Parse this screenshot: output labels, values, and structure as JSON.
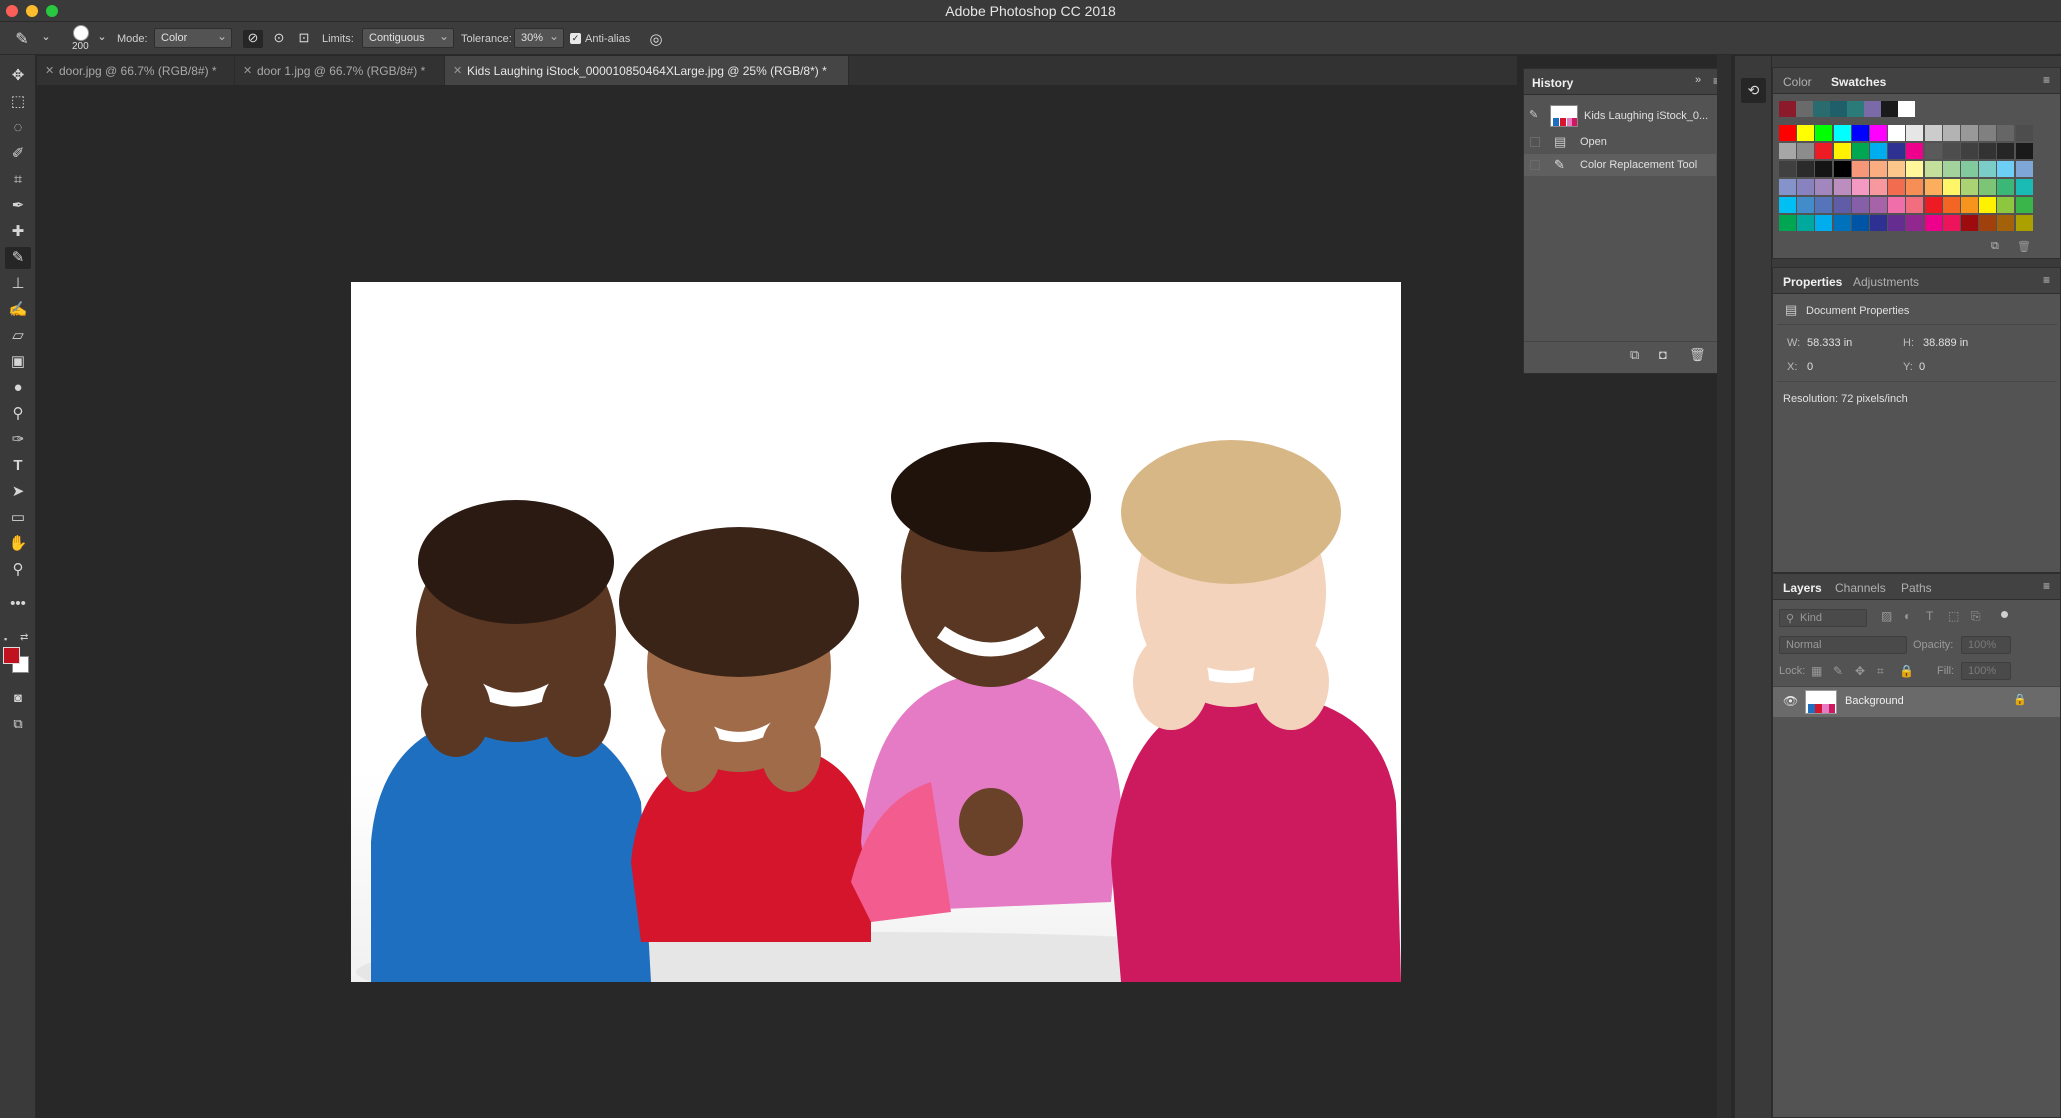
{
  "app": {
    "title": "Adobe Photoshop CC 2018"
  },
  "options_bar": {
    "brush_size": "200",
    "mode_label": "Mode:",
    "mode_value": "Color",
    "limits_label": "Limits:",
    "limits_value": "Contiguous",
    "tolerance_label": "Tolerance:",
    "tolerance_value": "30%",
    "antialias_label": "Anti-alias",
    "antialias_checked": true
  },
  "doc_tabs": [
    {
      "label": "door.jpg @ 66.7% (RGB/8#) *"
    },
    {
      "label": "door 1.jpg @ 66.7% (RGB/8#) *"
    },
    {
      "label": "Kids Laughing iStock_000010850464XLarge.jpg @ 25% (RGB/8*) *"
    }
  ],
  "history": {
    "tab": "History",
    "snapshot_label": "Kids Laughing iStock_0...",
    "items": [
      {
        "label": "Open"
      },
      {
        "label": "Color Replacement Tool"
      }
    ]
  },
  "color_panel": {
    "tabs": [
      "Color",
      "Swatches"
    ],
    "recent": [
      "#8b1a2b",
      "#6a6a6a",
      "#2a6b6f",
      "#1e5f6a",
      "#2b7b7b",
      "#7a6aa8",
      "#1a1a1a",
      "#ffffff"
    ],
    "rows": [
      [
        "#ff0000",
        "#ffff00",
        "#00ff00",
        "#00ffff",
        "#0000ff",
        "#ff00ff",
        "#ffffff",
        "#e6e6e6",
        "#cccccc",
        "#b3b3b3",
        "#999999",
        "#808080",
        "#666666",
        "#4d4d4d"
      ],
      [
        "#a6a6a6",
        "#8c8c8c",
        "#ed1c24",
        "#fff200",
        "#00a651",
        "#00aeef",
        "#2e3192",
        "#ec008c",
        "#5a5a5a",
        "#4d4d4d",
        "#404040",
        "#333333",
        "#262626",
        "#1a1a1a"
      ],
      [
        "#404040",
        "#2b2b2b",
        "#151515",
        "#000000",
        "#f7977a",
        "#f9ad81",
        "#fdc68a",
        "#fff79a",
        "#c4df9b",
        "#a3d39c",
        "#82ca9d",
        "#7bcdc8",
        "#6ecff6",
        "#7ea7d8"
      ],
      [
        "#8493ca",
        "#8882be",
        "#a187be",
        "#bc8dbf",
        "#f49ac2",
        "#f6989d",
        "#f26c4f",
        "#f68e56",
        "#fbaf5d",
        "#fff568",
        "#acd373",
        "#7cc576",
        "#3bb878",
        "#1abbb4"
      ],
      [
        "#00bff3",
        "#438cca",
        "#5574b9",
        "#605ca8",
        "#855fa8",
        "#a763a8",
        "#f06eaa",
        "#f26d7d",
        "#ed1c24",
        "#f26522",
        "#f7941d",
        "#fff200",
        "#8dc73f",
        "#39b54a"
      ],
      [
        "#00a651",
        "#00a99d",
        "#00aeef",
        "#0072bc",
        "#0054a6",
        "#2e3192",
        "#662d91",
        "#92278f",
        "#ec008c",
        "#ed145b",
        "#9e0b0f",
        "#a0410d",
        "#a36209",
        "#aba000"
      ]
    ]
  },
  "properties": {
    "tabs": [
      "Properties",
      "Adjustments"
    ],
    "section": "Document Properties",
    "w_label": "W:",
    "w": "58.333 in",
    "h_label": "H:",
    "h": "38.889 in",
    "x_label": "X:",
    "x": "0",
    "y_label": "Y:",
    "y": "0",
    "resolution": "Resolution: 72 pixels/inch"
  },
  "layers": {
    "tabs": [
      "Layers",
      "Channels",
      "Paths"
    ],
    "kind_placeholder": "Kind",
    "blend_mode": "Normal",
    "opacity_label": "Opacity:",
    "opacity_value": "100%",
    "lock_label": "Lock:",
    "fill_label": "Fill:",
    "fill_value": "100%",
    "layer_name": "Background"
  },
  "colors": {
    "foreground": "#c1121f",
    "background": "#ffffff"
  }
}
